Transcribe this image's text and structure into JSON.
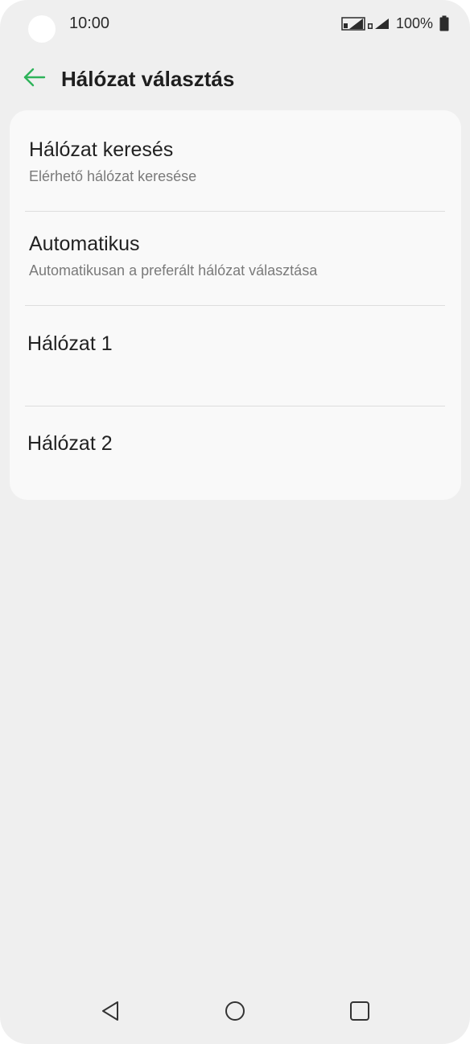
{
  "status_bar": {
    "time": "10:00",
    "battery_percent": "100%",
    "icons": [
      "sim1-signal-icon",
      "sim2-signal-icon",
      "battery-icon"
    ]
  },
  "header": {
    "title": "Hálózat választás",
    "back_icon": "arrow-left-icon"
  },
  "menu": {
    "items": [
      {
        "title": "Hálózat keresés",
        "subtitle": "Elérhető hálózat keresése"
      },
      {
        "title": "Automatikus",
        "subtitle": "Automatikusan a preferált hálózat választása"
      },
      {
        "title": "Hálózat 1"
      },
      {
        "title": "Hálózat 2"
      }
    ]
  },
  "nav_bar": {
    "icons": [
      "nav-back-icon",
      "nav-home-icon",
      "nav-recent-apps-icon"
    ]
  },
  "colors": {
    "accent": "#2eb35a",
    "background": "#efefef",
    "card": "#f9f9f9",
    "primary_text": "#222222",
    "secondary_text": "#7a7a7a"
  }
}
